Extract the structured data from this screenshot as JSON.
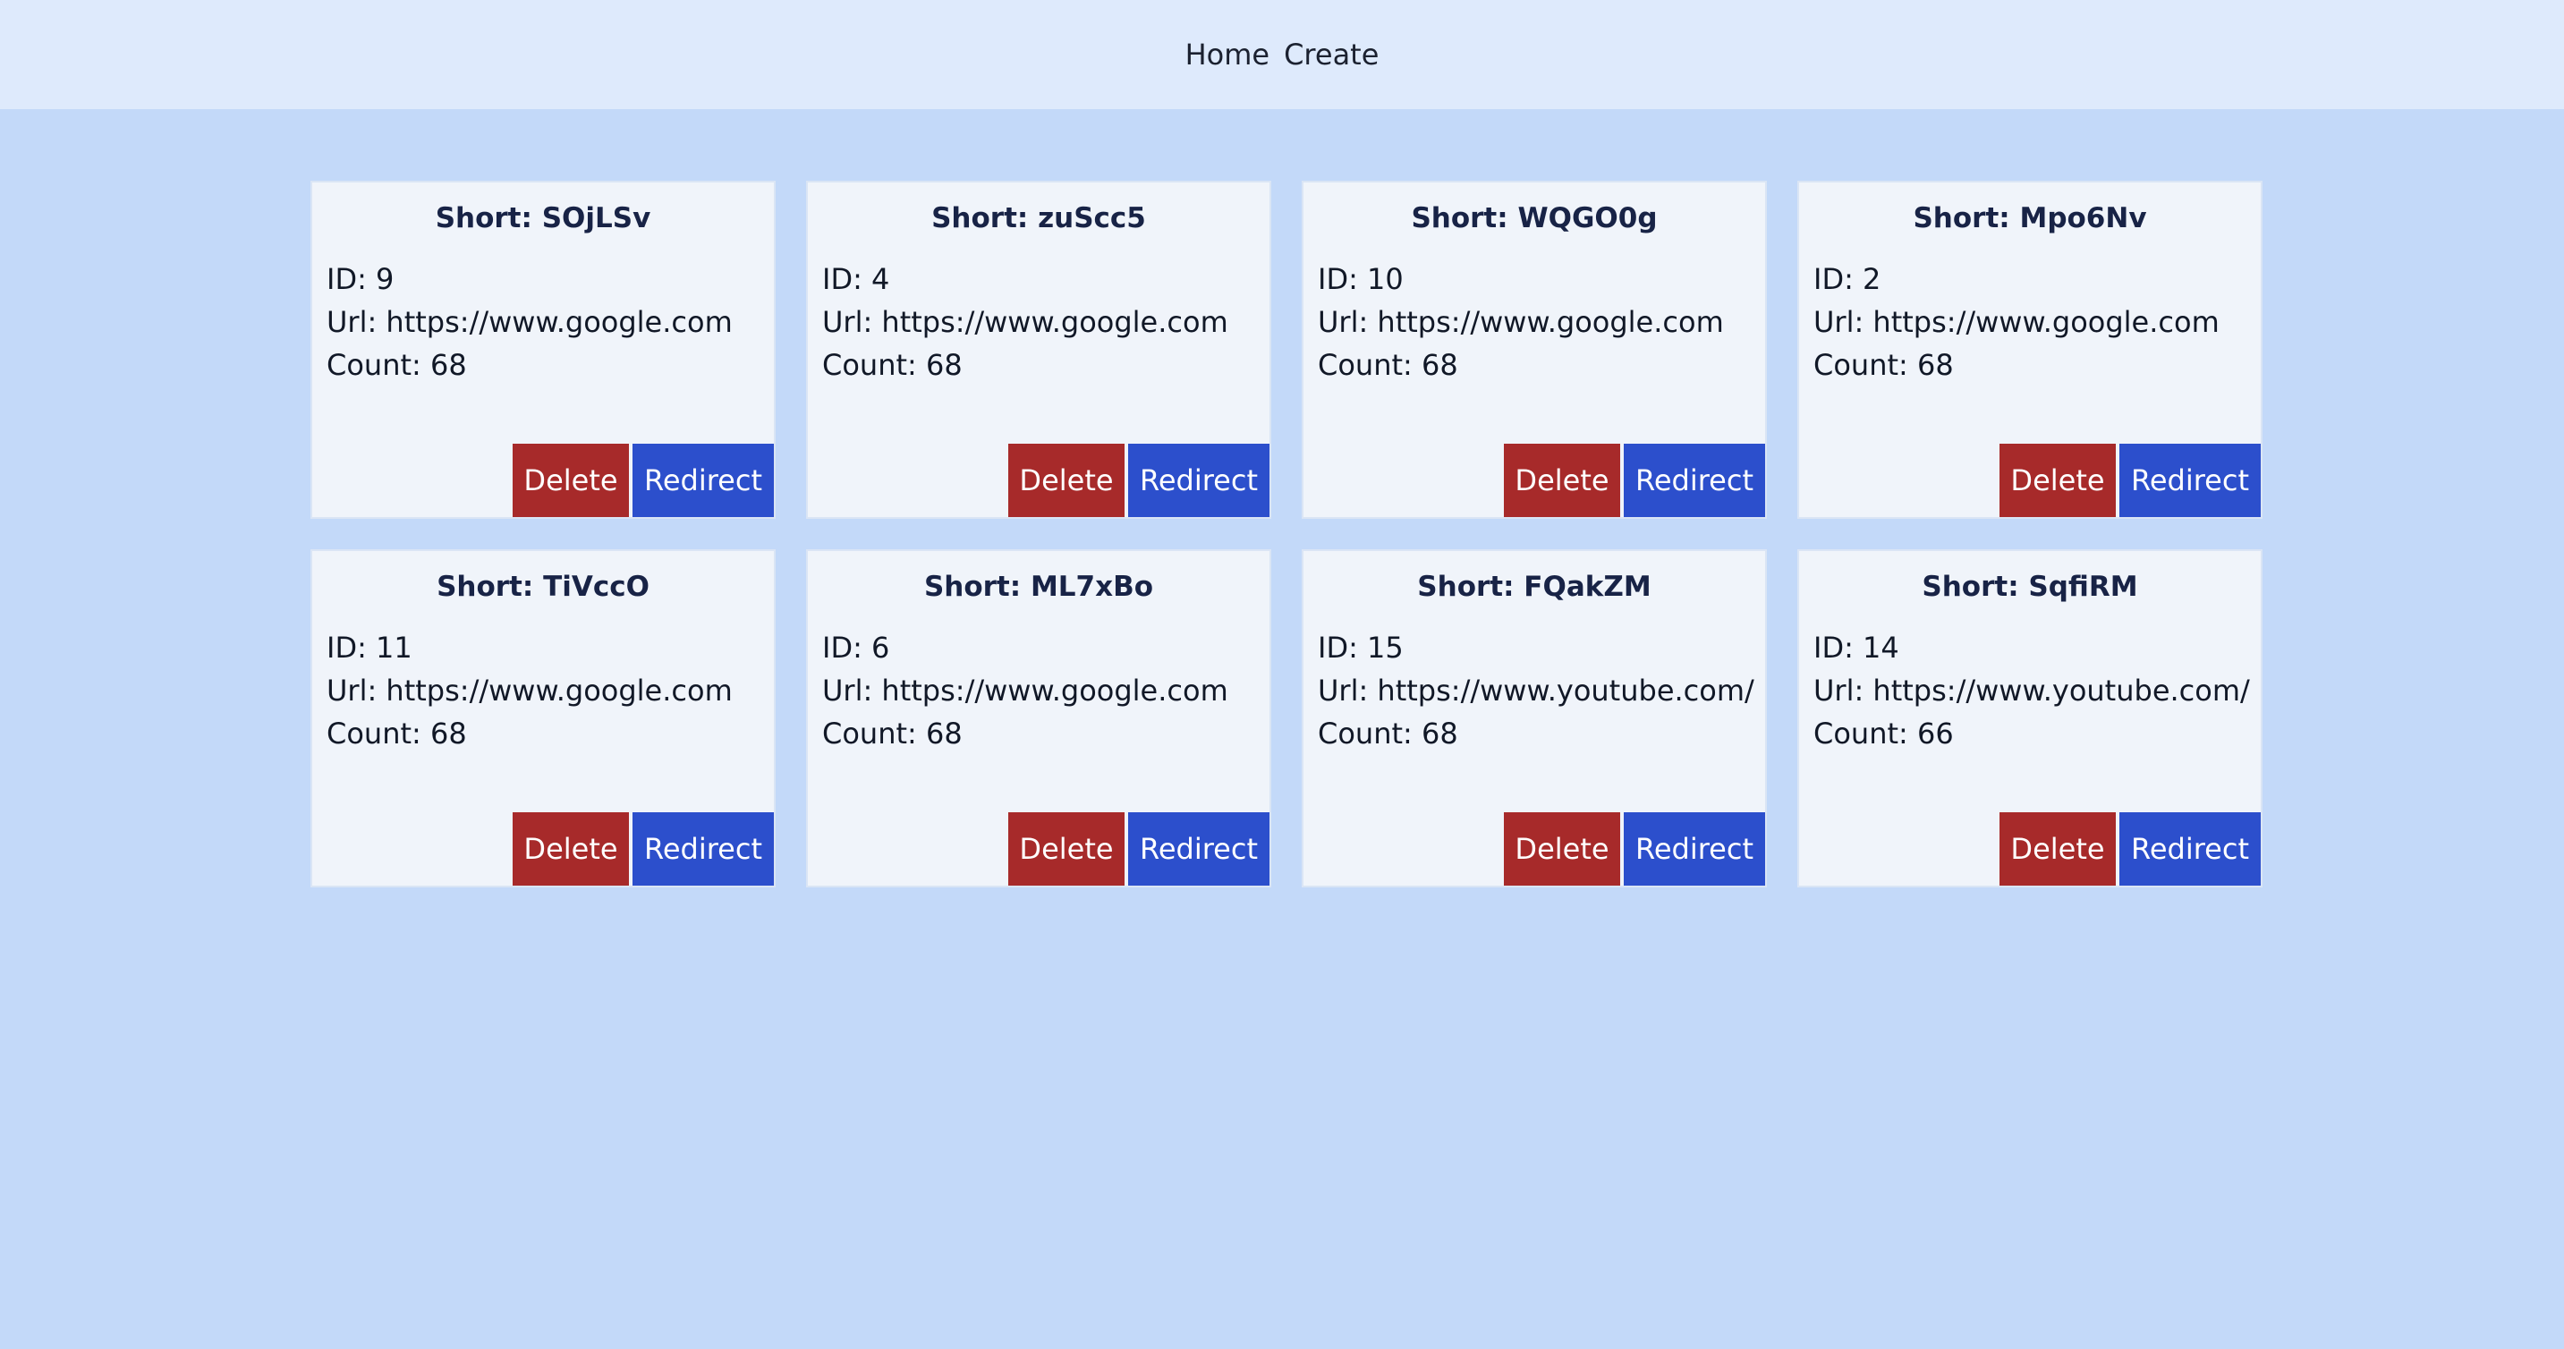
{
  "nav": {
    "home_label": "Home",
    "create_label": "Create"
  },
  "labels": {
    "short_prefix": "Short: ",
    "id_prefix": "ID: ",
    "url_prefix": "Url: ",
    "count_prefix": "Count: ",
    "delete": "Delete",
    "redirect": "Redirect"
  },
  "colors": {
    "page_background": "#c3d9f9",
    "nav_background": "#deeafc",
    "card_background": "#f0f4fa",
    "delete_button": "#a72a2a",
    "redirect_button": "#2c4fcc"
  },
  "links": [
    {
      "short": "SOjLSv",
      "id": "9",
      "url": "https://www.google.com",
      "count": "68"
    },
    {
      "short": "zuScc5",
      "id": "4",
      "url": "https://www.google.com",
      "count": "68"
    },
    {
      "short": "WQGO0g",
      "id": "10",
      "url": "https://www.google.com",
      "count": "68"
    },
    {
      "short": "Mpo6Nv",
      "id": "2",
      "url": "https://www.google.com",
      "count": "68"
    },
    {
      "short": "TiVccO",
      "id": "11",
      "url": "https://www.google.com",
      "count": "68"
    },
    {
      "short": "ML7xBo",
      "id": "6",
      "url": "https://www.google.com",
      "count": "68"
    },
    {
      "short": "FQakZM",
      "id": "15",
      "url": "https://www.youtube.com/",
      "count": "68"
    },
    {
      "short": "SqfiRM",
      "id": "14",
      "url": "https://www.youtube.com/",
      "count": "66"
    }
  ]
}
